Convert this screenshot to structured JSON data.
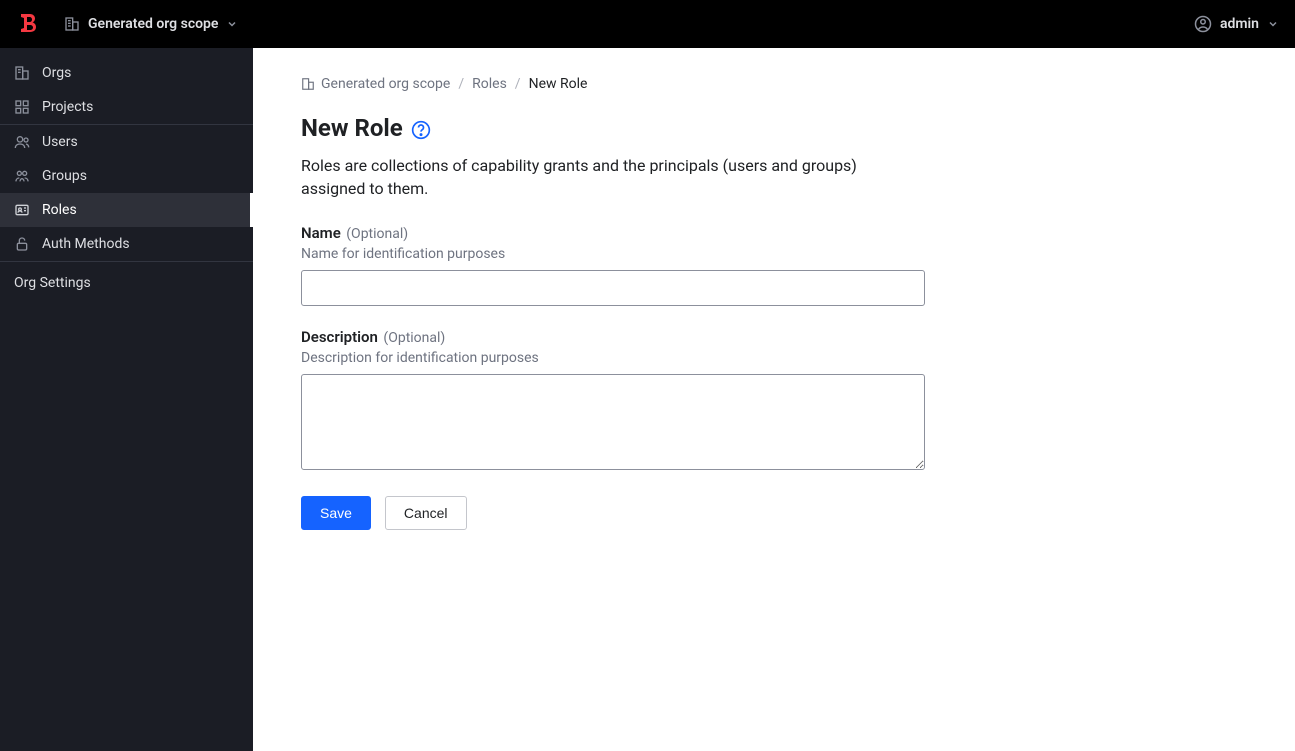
{
  "header": {
    "scope_label": "Generated org scope",
    "user_label": "admin"
  },
  "sidebar": {
    "sections": {
      "orgs": "Orgs",
      "projects": "Projects",
      "users": "Users",
      "groups": "Groups",
      "roles": "Roles",
      "auth_methods": "Auth Methods"
    },
    "settings": "Org Settings"
  },
  "breadcrumbs": {
    "scope": "Generated org scope",
    "roles": "Roles",
    "current": "New Role"
  },
  "page": {
    "title": "New Role",
    "description": "Roles are collections of capability grants and the principals (users and groups) assigned to them."
  },
  "form": {
    "name_label": "Name",
    "name_optional": "(Optional)",
    "name_help": "Name for identification purposes",
    "name_value": "",
    "description_label": "Description",
    "description_optional": "(Optional)",
    "description_help": "Description for identification purposes",
    "description_value": ""
  },
  "buttons": {
    "save": "Save",
    "cancel": "Cancel"
  }
}
